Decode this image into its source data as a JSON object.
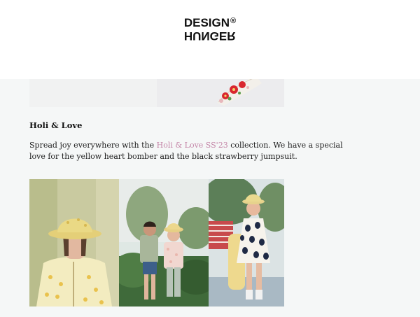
{
  "brand": {
    "line1": "DESIGN",
    "registered": "®",
    "line2": "HUNGER"
  },
  "article": {
    "title": "Holi & Love",
    "text_before": "Spread joy everywhere with the ",
    "link_text": "Holi & Love SS'23",
    "text_after_line1": " collection. We have a special",
    "text_line2": "love for the yellow heart bomber and the black strawberry jumpsuit."
  },
  "colors": {
    "link": "#c486a8",
    "background": "#f5f7f7",
    "header": "#ffffff"
  },
  "images": [
    {
      "name": "girl-yellow-bucket-hat-photo"
    },
    {
      "name": "two-kids-garden-photo"
    },
    {
      "name": "girl-black-strawberry-jumpsuit-photo"
    }
  ]
}
